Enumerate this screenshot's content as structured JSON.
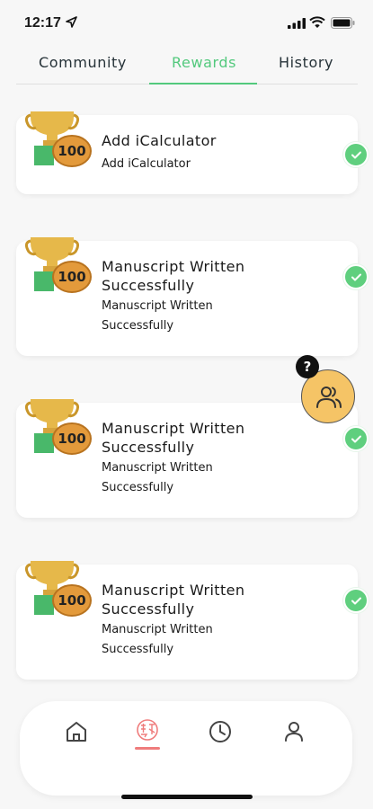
{
  "status_bar": {
    "time": "12:17"
  },
  "tabs": [
    {
      "label": "Community",
      "active": false
    },
    {
      "label": "Rewards",
      "active": true
    },
    {
      "label": "History",
      "active": false
    }
  ],
  "accent_color": "#53c97d",
  "rewards": [
    {
      "points": "100",
      "title": "Add iCalculator",
      "subtitle": "Add iCalculator",
      "completed": true
    },
    {
      "points": "100",
      "title": "Manuscript Written Successfully",
      "subtitle": "Manuscript Written Successfully",
      "completed": true
    },
    {
      "points": "100",
      "title": "Manuscript Written Successfully",
      "subtitle": "Manuscript Written Successfully",
      "completed": true
    },
    {
      "points": "100",
      "title": "Manuscript Written Successfully",
      "subtitle": "Manuscript Written Successfully",
      "completed": true
    }
  ],
  "help_badge": "?",
  "bottom_nav": [
    {
      "icon": "home-icon",
      "active": false
    },
    {
      "icon": "rewards-icon",
      "active": true
    },
    {
      "icon": "clock-icon",
      "active": false
    },
    {
      "icon": "profile-icon",
      "active": false
    }
  ]
}
